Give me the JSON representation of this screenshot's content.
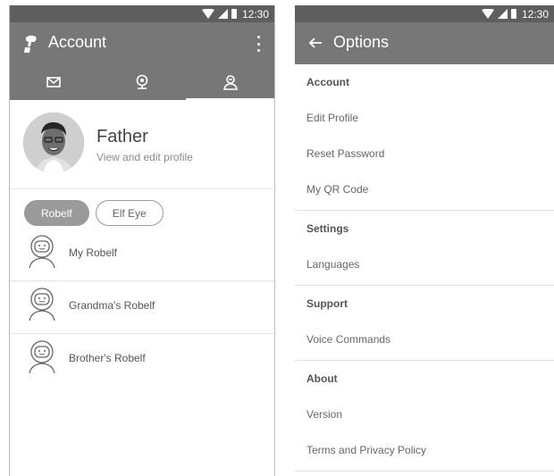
{
  "status": {
    "time": "12:30"
  },
  "left": {
    "title": "Account",
    "tabs": [
      {
        "icon": "mail-icon"
      },
      {
        "icon": "webcam-icon"
      },
      {
        "icon": "person-icon"
      }
    ],
    "profile": {
      "name": "Father",
      "subtitle": "View and edit profile"
    },
    "chips": [
      {
        "label": "Robelf",
        "selected": true
      },
      {
        "label": "Elf Eye",
        "selected": false
      }
    ],
    "robots": [
      {
        "name": "My Robelf"
      },
      {
        "name": "Grandma's Robelf"
      },
      {
        "name": "Brother's Robelf"
      }
    ]
  },
  "right": {
    "title": "Options",
    "sections": [
      {
        "header": "Account",
        "items": [
          "Edit Profile",
          "Reset Password",
          "My QR Code"
        ]
      },
      {
        "header": "Settings",
        "items": [
          "Languages"
        ]
      },
      {
        "header": "Support",
        "items": [
          "Voice Commands"
        ]
      },
      {
        "header": "About",
        "items": [
          "Version",
          "Terms and Privacy Policy"
        ]
      }
    ]
  }
}
